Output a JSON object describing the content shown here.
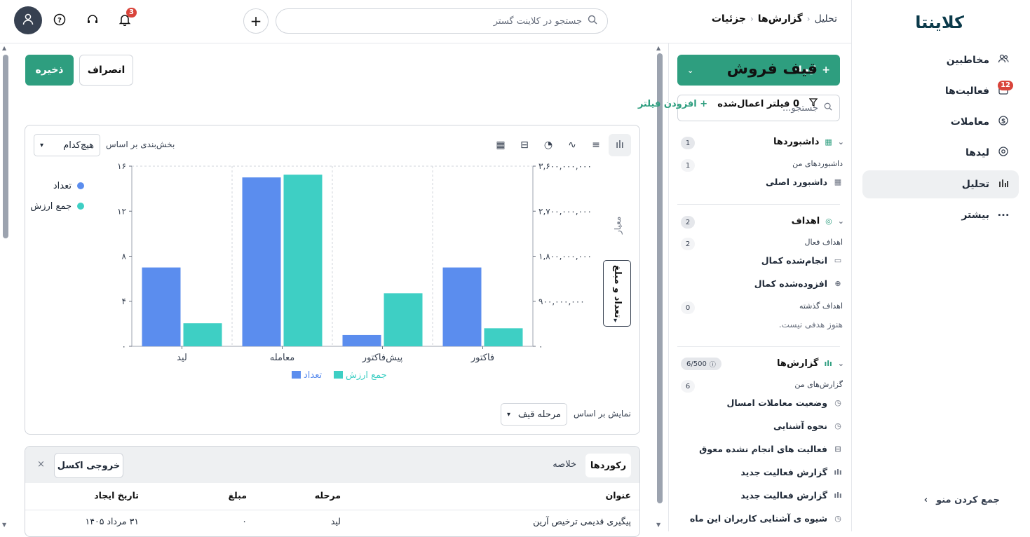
{
  "brand": {
    "logo": "کلاینتا",
    "accent": "#2e9e7f"
  },
  "nav": {
    "items": [
      {
        "label": "مخاطبین",
        "icon": "users-icon"
      },
      {
        "label": "فعالیت‌ها",
        "icon": "calendar-icon",
        "badge": "12"
      },
      {
        "label": "معاملات",
        "icon": "dollar-icon"
      },
      {
        "label": "لیدها",
        "icon": "target-icon"
      },
      {
        "label": "تحلیل",
        "icon": "bar-chart-icon"
      },
      {
        "label": "بیشتر",
        "icon": "more-icon"
      }
    ],
    "collapse": "جمع کردن منو"
  },
  "topbar": {
    "breadcrumb": [
      "تحلیل",
      "گزارش‌ها",
      "جزئیات"
    ],
    "search_placeholder": "جستجو در کلاینت گستر",
    "notification_count": "3"
  },
  "sidebar": {
    "create": "ایجاد",
    "search_placeholder": "جستجو...",
    "dashboards": {
      "title": "داشبوردها",
      "count": "1",
      "sub": "داشبوردهای من",
      "sub_count": "1",
      "items": [
        "داشبورد اصلی"
      ]
    },
    "goals": {
      "title": "اهداف",
      "count": "2",
      "active": "اهداف فعال",
      "active_count": "2",
      "items": [
        "انجام‌شده کمال",
        "افزوده‌شده کمال"
      ],
      "past": "اهداف گذشته",
      "past_count": "0",
      "empty": "هنوز هدفی نیست."
    },
    "reports": {
      "title": "گزارش‌ها",
      "count": "6/500",
      "sub": "گزارش‌های من",
      "sub_count": "6",
      "items": [
        "وضعیت معاملات امسال",
        "نحوه آشنایی",
        "فعالیت های انجام نشده معوق",
        "گزارش فعالیت جدید",
        "گزارش فعالیت جدید",
        "شیوه ی آشنایی کاربران این ماه"
      ]
    }
  },
  "main": {
    "title": "قیف فروش",
    "save": "ذخیره",
    "cancel": "انصراف",
    "filters_applied": "0 فیلتر اعمال‌شده",
    "add_filter": "+ افزودن فیلتر",
    "segment_label": "بخش‌بندی بر اساس",
    "segment_value": "هیچ‌کدام",
    "metric_label": "معیار",
    "metric_value": "تعداد و مبلغ",
    "view_label": "نمایش بر اساس",
    "view_value": "مرحله قیف"
  },
  "chart_data": {
    "type": "bar",
    "categories": [
      "لید",
      "معامله",
      "پیش‌فاکتور",
      "فاکتور"
    ],
    "series": [
      {
        "name": "تعداد",
        "color": "#5b8dee",
        "values": [
          7,
          15,
          1,
          7
        ]
      },
      {
        "name": "جمع ارزش",
        "color": "#3ecfc4",
        "values": [
          460000000,
          3430000000,
          1060000000,
          360000000
        ]
      }
    ],
    "y_left": {
      "ticks": [
        "۰",
        "۴",
        "۸",
        "۱۲",
        "۱۶"
      ],
      "max": 16
    },
    "y_right": {
      "ticks": [
        "۰",
        "۹۰۰,۰۰۰,۰۰۰",
        "۱,۸۰۰,۰۰۰,۰۰۰",
        "۲,۷۰۰,۰۰۰,۰۰۰",
        "۳,۶۰۰,۰۰۰,۰۰۰"
      ],
      "max": 3600000000
    },
    "legend_position": "top-right",
    "grid": true
  },
  "table": {
    "tabs": [
      "رکوردها",
      "خلاصه"
    ],
    "export": "خروجی اکسل",
    "close": "×",
    "headers": [
      "عنوان",
      "مرحله",
      "مبلغ",
      "تاریخ ایجاد"
    ],
    "rows": [
      [
        "پیگیری قدیمی ترخیص آرین",
        "لید",
        "۰",
        "۳۱ مرداد ۱۴۰۵"
      ]
    ]
  }
}
